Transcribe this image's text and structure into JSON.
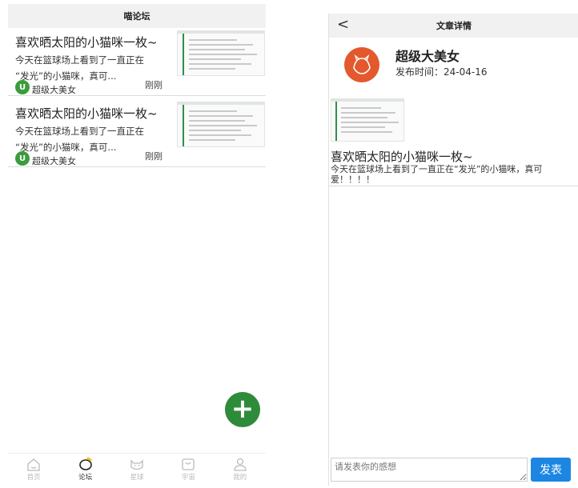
{
  "forum": {
    "title": "喵论坛",
    "posts": [
      {
        "title": "喜欢晒太阳的小猫咪一枚~",
        "excerpt_line1": "今天在篮球场上看到了一直正在",
        "excerpt_line2": "“发光”的小猫咪，真可...",
        "author": "超级大美女",
        "time": "刚刚"
      },
      {
        "title": "喜欢晒太阳的小猫咪一枚~",
        "excerpt_line1": "今天在篮球场上看到了一直正在",
        "excerpt_line2": "“发光”的小猫咪，真可...",
        "author": "超级大美女",
        "time": "刚刚"
      }
    ],
    "fab_label": "+",
    "tabs": [
      {
        "label": "首页",
        "icon": "home-icon"
      },
      {
        "label": "论坛",
        "icon": "forum-icon"
      },
      {
        "label": "星球",
        "icon": "cat-icon"
      },
      {
        "label": "宇宙",
        "icon": "universe-icon"
      },
      {
        "label": "我的",
        "icon": "profile-icon"
      }
    ]
  },
  "detail": {
    "back_glyph": "<",
    "header": "文章详情",
    "author": "超级大美女",
    "pub_time": "发布时间：24-04-16",
    "title": "喜欢晒太阳的小猫咪一枚~",
    "body": "今天在篮球场上看到了一直正在“发光”的小猫咪，真可爱！！！！",
    "comment_placeholder": "请发表你的感想",
    "send_label": "发表"
  },
  "colors": {
    "accent_green": "#2e8b3a",
    "avatar_orange": "#e3582d",
    "send_blue": "#1d86e3"
  }
}
